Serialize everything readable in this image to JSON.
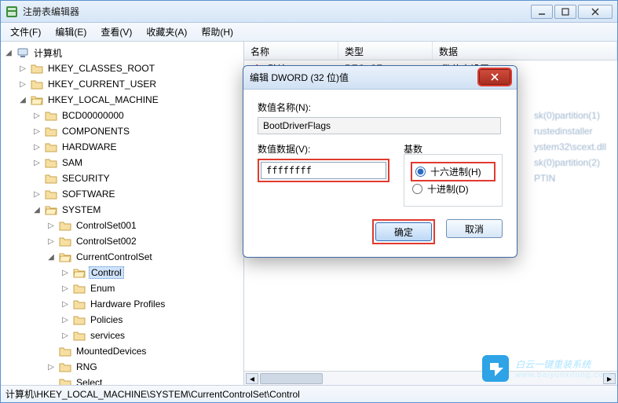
{
  "window": {
    "title": "注册表编辑器",
    "min": "–",
    "max": "□",
    "close": "×"
  },
  "menu": {
    "file": "文件(F)",
    "edit": "编辑(E)",
    "view": "查看(V)",
    "fav": "收藏夹(A)",
    "help": "帮助(H)"
  },
  "columns": {
    "name": "名称",
    "type": "类型",
    "data": "数据"
  },
  "tree": {
    "root": "计算机",
    "hkcr": "HKEY_CLASSES_ROOT",
    "hkcu": "HKEY_CURRENT_USER",
    "hklm": "HKEY_LOCAL_MACHINE",
    "bcd": "BCD00000000",
    "components": "COMPONENTS",
    "hardware": "HARDWARE",
    "sam": "SAM",
    "security": "SECURITY",
    "software": "SOFTWARE",
    "system": "SYSTEM",
    "cs001": "ControlSet001",
    "cs002": "ControlSet002",
    "ccs": "CurrentControlSet",
    "control": "Control",
    "enum": "Enum",
    "hwprof": "Hardware Profiles",
    "policies": "Policies",
    "services": "services",
    "mounted": "MountedDevices",
    "rng": "RNG",
    "select": "Select"
  },
  "list": {
    "default_name": "(默认)",
    "default_type": "REG_SZ",
    "default_data": "(数值未设置)",
    "r1": "sk(0)partition(1)",
    "r2": "rustedinstaller",
    "r3": "ystem32\\scext.dll",
    "r4": "sk(0)partition(2)",
    "r5": "PTIN"
  },
  "dialog": {
    "title": "编辑 DWORD (32 位)值",
    "name_label": "数值名称(N):",
    "name_value": "BootDriverFlags",
    "data_label": "数值数据(V):",
    "data_value": "ffffffff",
    "base_label": "基数",
    "hex": "十六进制(H)",
    "dec": "十进制(D)",
    "ok": "确定",
    "cancel": "取消"
  },
  "status": {
    "path": "计算机\\HKEY_LOCAL_MACHINE\\SYSTEM\\CurrentControlSet\\Control"
  },
  "watermark": {
    "brand": "白云一键重装系统",
    "url": "www.baiyunxitong.com"
  }
}
